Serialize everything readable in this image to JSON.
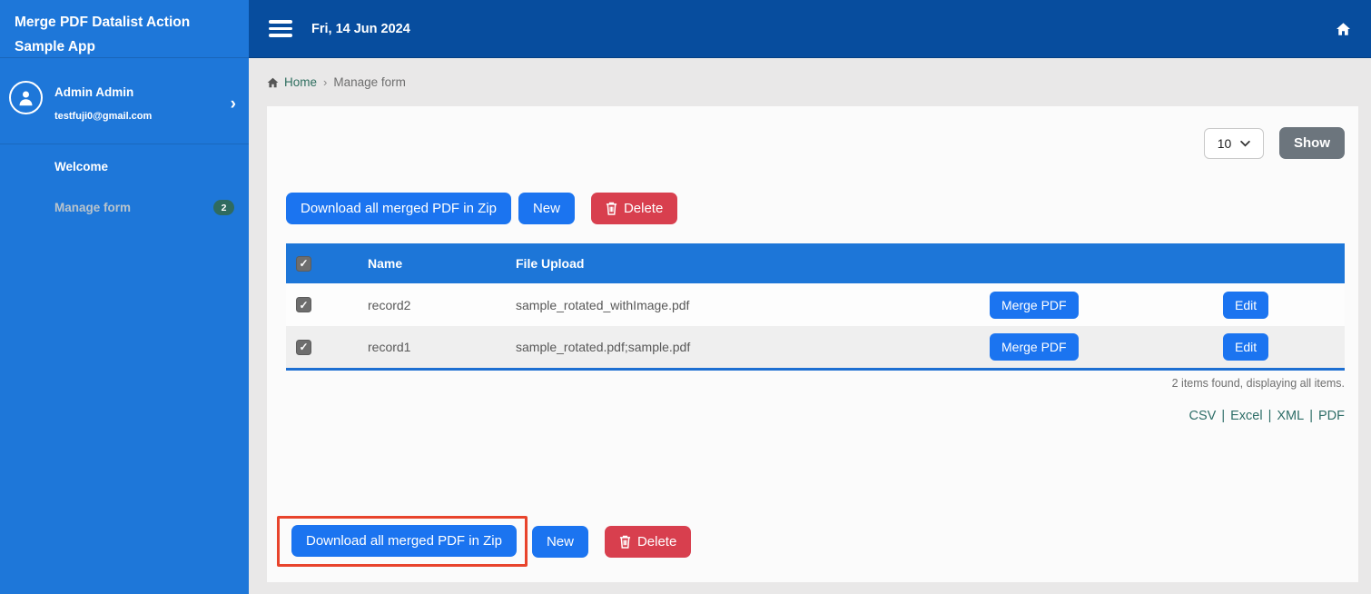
{
  "sidebar": {
    "app_title": "Merge PDF Datalist Action Sample App",
    "user": {
      "name": "Admin Admin",
      "email": "testfuji0@gmail.com"
    },
    "items": [
      {
        "label": "Welcome"
      },
      {
        "label": "Manage form",
        "badge": "2"
      }
    ]
  },
  "topbar": {
    "date": "Fri, 14 Jun 2024"
  },
  "breadcrumb": {
    "home": "Home",
    "separator": "›",
    "current": "Manage form"
  },
  "toolbar": {
    "page_size": "10",
    "show_label": "Show",
    "download_label": "Download all merged PDF in Zip",
    "new_label": "New",
    "delete_label": "Delete"
  },
  "table": {
    "columns": [
      "Name",
      "File Upload"
    ],
    "rows": [
      {
        "name": "record2",
        "file": "sample_rotated_withImage.pdf",
        "merge_label": "Merge PDF",
        "edit_label": "Edit"
      },
      {
        "name": "record1",
        "file": "sample_rotated.pdf;sample.pdf",
        "merge_label": "Merge PDF",
        "edit_label": "Edit"
      }
    ],
    "summary": "2 items found, displaying all items.",
    "export_links": [
      "CSV",
      "Excel",
      "XML",
      "PDF"
    ],
    "export_separator": "|"
  },
  "icons": {
    "menu": "hamburger-icon",
    "home": "home-icon",
    "user": "user-circle-icon",
    "chevron_right": "chevron-right-icon",
    "chevron_down": "chevron-down-icon",
    "trash": "trash-icon",
    "checkbox": "checked-checkbox"
  },
  "colors": {
    "sidebar_blue": "#1e77d9",
    "topbar_blue": "#074d9e",
    "button_blue": "#1b74f0",
    "table_header_blue": "#1d76d8",
    "delete_red": "#d83f4e",
    "show_gray": "#6c757d",
    "badge_teal": "#2f6b5f",
    "link_teal": "#2e6e68",
    "highlight_red": "#e8442c",
    "page_bg": "#e9e8e8",
    "card_bg": "#fbfbfb"
  }
}
